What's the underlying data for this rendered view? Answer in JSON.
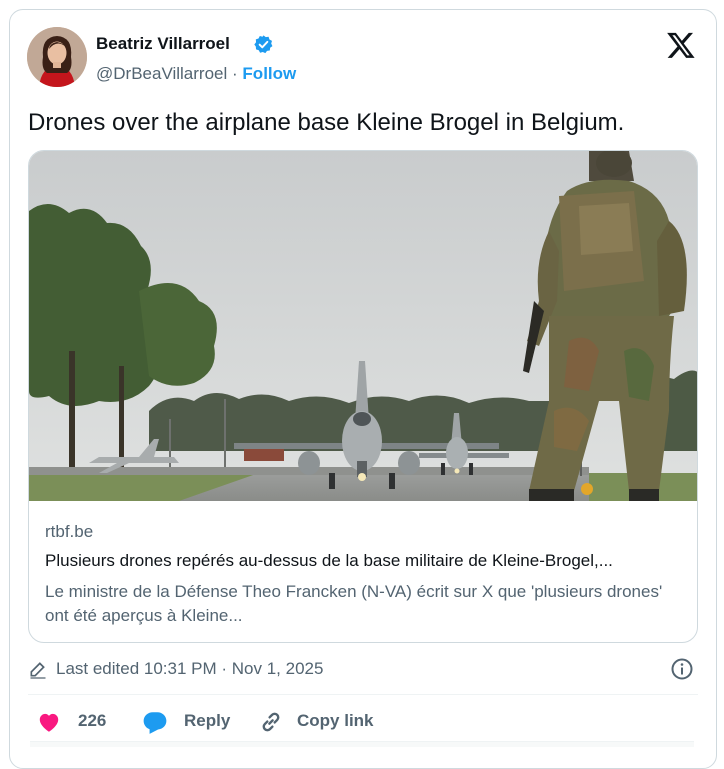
{
  "author": {
    "name": "Beatriz Villarroel",
    "handle": "@DrBeaVillarroel",
    "separator": "·",
    "follow_label": "Follow",
    "verified_color": "#1d9bf0"
  },
  "tweet": {
    "text": "Drones over the airplane base Kleine Brogel in Belgium."
  },
  "link_card": {
    "domain": "rtbf.be",
    "title": "Plusieurs drones repérés au-dessus de la base militaire de Kleine-Brogel,...",
    "description": "Le ministre de la Défense Theo Francken (N-VA) écrit sur X que 'plusieurs drones' ont été aperçus à Kleine..."
  },
  "meta": {
    "edited_text": "Last edited 10:31 PM · Nov 1, 2025"
  },
  "actions": {
    "like_count": "226",
    "reply_label": "Reply",
    "copy_label": "Copy link",
    "like_color": "#f91880",
    "reply_color": "#1d9bf0"
  },
  "icons": [
    "x-logo-icon",
    "verified-badge-icon",
    "pencil-icon",
    "info-icon",
    "heart-icon",
    "reply-bubble-icon",
    "link-icon"
  ]
}
